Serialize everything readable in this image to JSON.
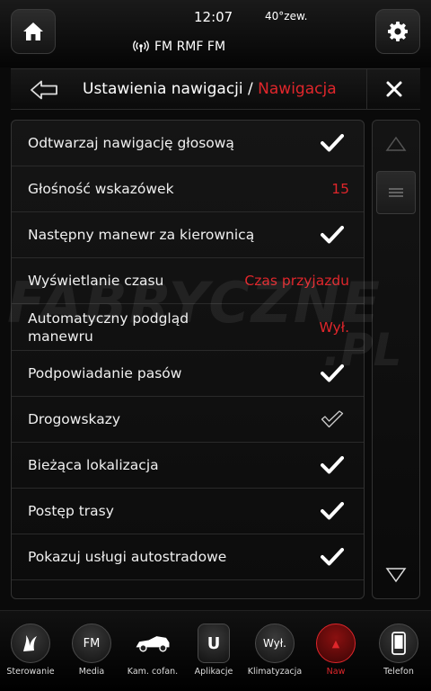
{
  "status": {
    "time": "12:07",
    "temperature": "40°zew.",
    "radio": "FM RMF FM"
  },
  "header": {
    "title_main": "Ustawienia nawigacji / ",
    "title_accent": "Nawigacja"
  },
  "settings": [
    {
      "label": "Odtwarzaj nawigację głosową",
      "value": "",
      "check": "on"
    },
    {
      "label": "Głośność wskazówek",
      "value": "15",
      "check": ""
    },
    {
      "label": "Następny manewr za kierownicą",
      "value": "",
      "check": "on"
    },
    {
      "label": "Wyświetlanie czasu",
      "value": "Czas przyjazdu",
      "check": ""
    },
    {
      "label": "Automatyczny podgląd manewru",
      "value": "Wył.",
      "check": ""
    },
    {
      "label": "Podpowiadanie pasów",
      "value": "",
      "check": "on"
    },
    {
      "label": "Drogowskazy",
      "value": "",
      "check": "outline"
    },
    {
      "label": "Bieżąca lokalizacja",
      "value": "",
      "check": "on"
    },
    {
      "label": "Postęp trasy",
      "value": "",
      "check": "on"
    },
    {
      "label": "Pokazuj usługi autostradowe",
      "value": "",
      "check": "on"
    }
  ],
  "watermark": {
    "line1": "FABRYCZNE",
    "line2": ".PL"
  },
  "bottom_nav": [
    {
      "label": "Sterowanie",
      "icon": "steering-icon",
      "text": ""
    },
    {
      "label": "Media",
      "icon": "fm-icon",
      "text": "FM"
    },
    {
      "label": "Kam. cofan.",
      "icon": "rear-camera-icon",
      "text": ""
    },
    {
      "label": "Aplikacje",
      "icon": "apps-icon",
      "text": "U"
    },
    {
      "label": "Klimatyzacja",
      "icon": "climate-icon",
      "text": "Wył."
    },
    {
      "label": "Naw",
      "icon": "navigation-icon",
      "text": "▲"
    },
    {
      "label": "Telefon",
      "icon": "phone-icon",
      "text": ""
    }
  ],
  "colors": {
    "accent": "#e0262b",
    "background": "#0a0a0a",
    "text": "#f2f2f2"
  }
}
